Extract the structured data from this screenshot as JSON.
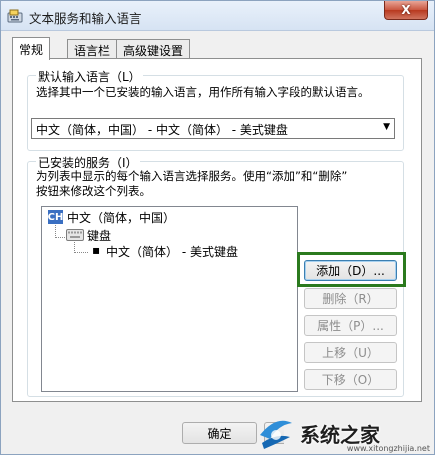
{
  "window": {
    "title": "文本服务和输入语言",
    "close_label": "X"
  },
  "tabs": [
    {
      "label": "常规",
      "active": true
    },
    {
      "label": "语言栏",
      "active": false
    },
    {
      "label": "高级键设置",
      "active": false
    }
  ],
  "default_language": {
    "legend": "默认输入语言（L）",
    "description": "选择其中一个已安装的输入语言，用作所有输入字段的默认语言。",
    "selected": "中文（简体，中国） - 中文（简体） - 美式键盘"
  },
  "installed_services": {
    "legend": "已安装的服务（I）",
    "description_line1": "为列表中显示的每个输入语言选择服务。使用“添加”和“删除”",
    "description_line2": "按钮来修改这个列表。",
    "tree": {
      "language_badge": "CH",
      "language": "中文（简体，中国）",
      "category": "键盘",
      "service": "中文（简体） - 美式键盘"
    },
    "buttons": {
      "add": "添加（D）...",
      "remove": "删除（R）",
      "properties": "属性（P）...",
      "move_up": "上移（U）",
      "move_down": "下移（O）"
    }
  },
  "footer": {
    "ok_label": "确定"
  },
  "watermark": {
    "text": "系统之家",
    "small": "www.xitongzhijia.net"
  },
  "colors": {
    "highlight": "#2b7a1e",
    "badge": "#3a6fc2"
  }
}
